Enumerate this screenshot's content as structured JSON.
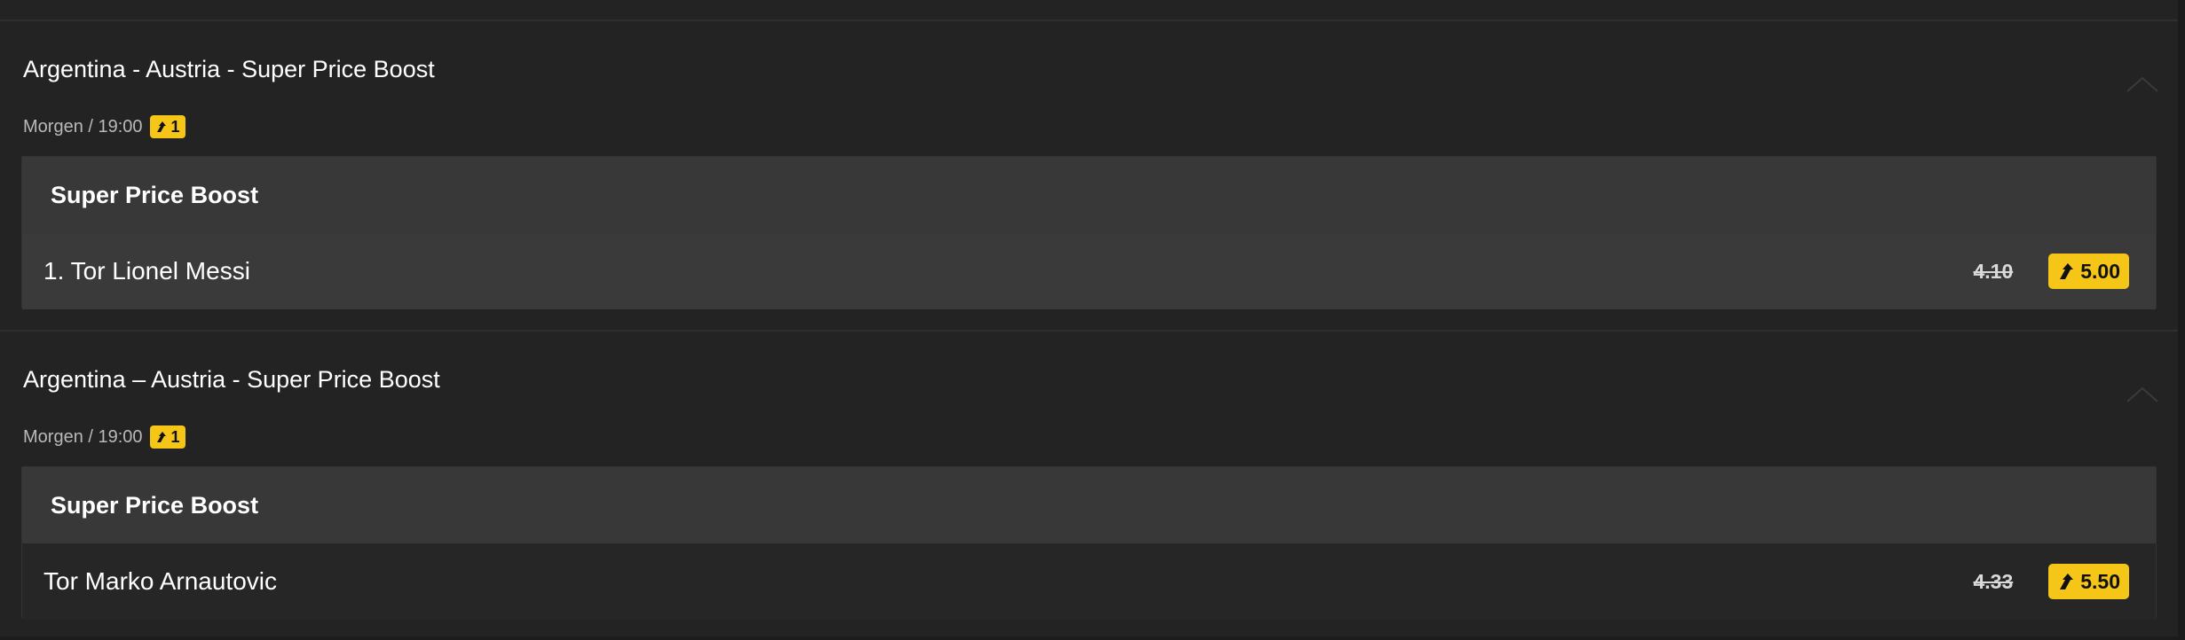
{
  "events": [
    {
      "title": "Argentina - Austria - Super Price Boost",
      "time": "Morgen / 19:00",
      "boost_count": "1",
      "market": {
        "header": "Super Price Boost",
        "selection": {
          "name": "1. Tor Lionel Messi",
          "old_odds": "4.10",
          "new_odds": "5.00"
        }
      }
    },
    {
      "title": "Argentina – Austria - Super Price Boost",
      "time": "Morgen / 19:00",
      "boost_count": "1",
      "market": {
        "header": "Super Price Boost",
        "selection": {
          "name": "Tor Marko Arnautovic",
          "old_odds": "4.33",
          "new_odds": "5.50"
        }
      }
    }
  ],
  "colors": {
    "accent": "#f5c518",
    "background": "#232323",
    "market_header": "#383838"
  },
  "icons": {
    "collapse": "chevron-up-icon",
    "boost": "boost-arrow-icon"
  }
}
